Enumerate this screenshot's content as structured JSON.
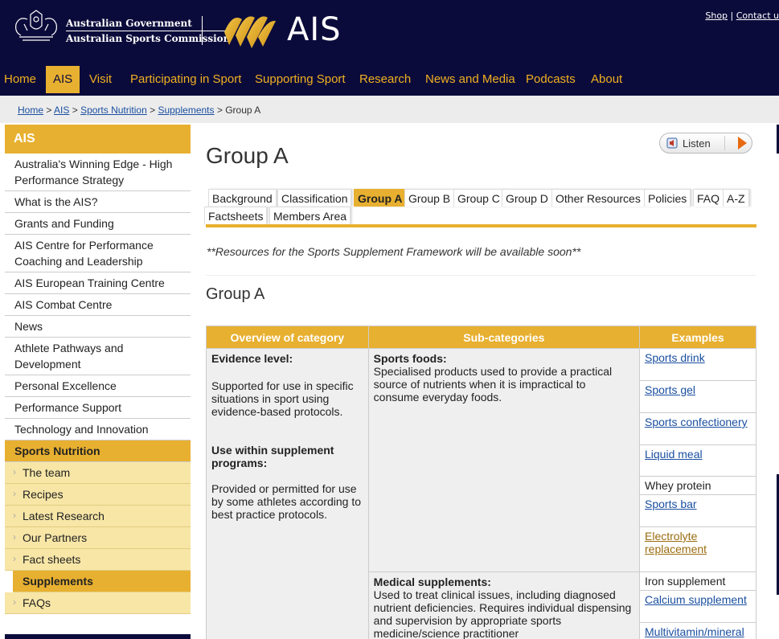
{
  "header": {
    "gov_line1": "Australian Government",
    "gov_line2": "Australian Sports Commission",
    "brand": "AIS",
    "util": {
      "shop": "Shop",
      "separator": " | ",
      "contact": "Contact u"
    },
    "colors": {
      "navy": "#0b0b3b",
      "gold": "#e8b030"
    }
  },
  "nav": {
    "items": [
      "Home",
      "AIS",
      "Visit",
      "Participating in Sport",
      "Supporting Sport",
      "Research",
      "News and Media",
      "Podcasts",
      "About"
    ],
    "active": "AIS"
  },
  "breadcrumb": {
    "home": "Home",
    "ais": "AIS",
    "nutrition": "Sports Nutrition",
    "supplements": "Supplements",
    "current": "Group A",
    "sep": " > "
  },
  "sidebar": {
    "heading": "AIS",
    "items": [
      "Australia's Winning Edge - High Performance Strategy",
      "What is the AIS?",
      "Grants and Funding",
      "AIS Centre for Performance Coaching and Leadership",
      "AIS European Training Centre",
      "AIS Combat Centre",
      "News",
      "Athlete Pathways and Development",
      "Personal Excellence",
      "Performance Support",
      "Technology and Innovation"
    ],
    "section": "Sports Nutrition",
    "subitems": [
      "The team",
      "Recipes",
      "Latest Research",
      "Our Partners",
      "Fact sheets"
    ],
    "current": "Supplements",
    "after": "FAQs"
  },
  "main": {
    "listen": "Listen",
    "title": "Group A",
    "tabs": [
      "Background",
      "Classification",
      "Group A",
      "Group B",
      "Group C",
      "Group D",
      "Other Resources",
      "Policies",
      "FAQ",
      "A-Z",
      "Factsheets",
      "Members Area"
    ],
    "active_tab": "Group A",
    "notice": "**Resources for the Sports Supplement Framework will be available soon**",
    "subheading": "Group A",
    "table": {
      "headers": [
        "Overview of category",
        "Sub-categories",
        "Examples"
      ],
      "overview": {
        "evidence_title": "Evidence level:",
        "evidence_text": "Supported for use in specific situations in sport using evidence-based protocols.",
        "use_title": "Use within supplement programs:",
        "use_text": "Provided or permitted for use by some athletes according to best practice protocols."
      },
      "sports_foods": {
        "title": "Sports foods:",
        "text": "Specialised products used to provide a practical source of nutrients when it is impractical to consume everyday foods.",
        "examples": [
          "Sports drink",
          "Sports gel",
          "Sports confectionery",
          "Liquid meal",
          "Whey protein",
          "Sports bar",
          "Electrolyte replacement"
        ]
      },
      "medical": {
        "title": "Medical supplements:",
        "text": "Used to treat clinical issues, including diagnosed nutrient deficiencies. Requires individual dispensing and supervision by appropriate sports medicine/science practitioner",
        "examples": [
          "Iron supplement",
          "Calcium supplement",
          "Multivitamin/mineral"
        ]
      }
    }
  }
}
